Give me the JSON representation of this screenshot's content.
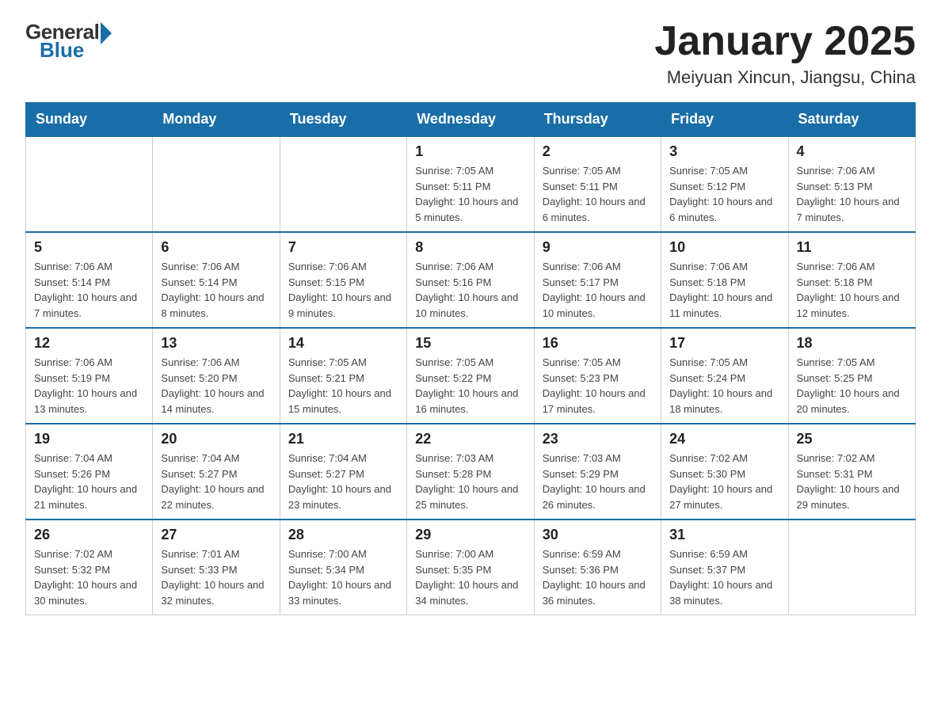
{
  "logo": {
    "general": "General",
    "blue": "Blue"
  },
  "title": "January 2025",
  "subtitle": "Meiyuan Xincun, Jiangsu, China",
  "days_header": [
    "Sunday",
    "Monday",
    "Tuesday",
    "Wednesday",
    "Thursday",
    "Friday",
    "Saturday"
  ],
  "weeks": [
    [
      {
        "day": "",
        "info": ""
      },
      {
        "day": "",
        "info": ""
      },
      {
        "day": "",
        "info": ""
      },
      {
        "day": "1",
        "info": "Sunrise: 7:05 AM\nSunset: 5:11 PM\nDaylight: 10 hours and 5 minutes."
      },
      {
        "day": "2",
        "info": "Sunrise: 7:05 AM\nSunset: 5:11 PM\nDaylight: 10 hours and 6 minutes."
      },
      {
        "day": "3",
        "info": "Sunrise: 7:05 AM\nSunset: 5:12 PM\nDaylight: 10 hours and 6 minutes."
      },
      {
        "day": "4",
        "info": "Sunrise: 7:06 AM\nSunset: 5:13 PM\nDaylight: 10 hours and 7 minutes."
      }
    ],
    [
      {
        "day": "5",
        "info": "Sunrise: 7:06 AM\nSunset: 5:14 PM\nDaylight: 10 hours and 7 minutes."
      },
      {
        "day": "6",
        "info": "Sunrise: 7:06 AM\nSunset: 5:14 PM\nDaylight: 10 hours and 8 minutes."
      },
      {
        "day": "7",
        "info": "Sunrise: 7:06 AM\nSunset: 5:15 PM\nDaylight: 10 hours and 9 minutes."
      },
      {
        "day": "8",
        "info": "Sunrise: 7:06 AM\nSunset: 5:16 PM\nDaylight: 10 hours and 10 minutes."
      },
      {
        "day": "9",
        "info": "Sunrise: 7:06 AM\nSunset: 5:17 PM\nDaylight: 10 hours and 10 minutes."
      },
      {
        "day": "10",
        "info": "Sunrise: 7:06 AM\nSunset: 5:18 PM\nDaylight: 10 hours and 11 minutes."
      },
      {
        "day": "11",
        "info": "Sunrise: 7:06 AM\nSunset: 5:18 PM\nDaylight: 10 hours and 12 minutes."
      }
    ],
    [
      {
        "day": "12",
        "info": "Sunrise: 7:06 AM\nSunset: 5:19 PM\nDaylight: 10 hours and 13 minutes."
      },
      {
        "day": "13",
        "info": "Sunrise: 7:06 AM\nSunset: 5:20 PM\nDaylight: 10 hours and 14 minutes."
      },
      {
        "day": "14",
        "info": "Sunrise: 7:05 AM\nSunset: 5:21 PM\nDaylight: 10 hours and 15 minutes."
      },
      {
        "day": "15",
        "info": "Sunrise: 7:05 AM\nSunset: 5:22 PM\nDaylight: 10 hours and 16 minutes."
      },
      {
        "day": "16",
        "info": "Sunrise: 7:05 AM\nSunset: 5:23 PM\nDaylight: 10 hours and 17 minutes."
      },
      {
        "day": "17",
        "info": "Sunrise: 7:05 AM\nSunset: 5:24 PM\nDaylight: 10 hours and 18 minutes."
      },
      {
        "day": "18",
        "info": "Sunrise: 7:05 AM\nSunset: 5:25 PM\nDaylight: 10 hours and 20 minutes."
      }
    ],
    [
      {
        "day": "19",
        "info": "Sunrise: 7:04 AM\nSunset: 5:26 PM\nDaylight: 10 hours and 21 minutes."
      },
      {
        "day": "20",
        "info": "Sunrise: 7:04 AM\nSunset: 5:27 PM\nDaylight: 10 hours and 22 minutes."
      },
      {
        "day": "21",
        "info": "Sunrise: 7:04 AM\nSunset: 5:27 PM\nDaylight: 10 hours and 23 minutes."
      },
      {
        "day": "22",
        "info": "Sunrise: 7:03 AM\nSunset: 5:28 PM\nDaylight: 10 hours and 25 minutes."
      },
      {
        "day": "23",
        "info": "Sunrise: 7:03 AM\nSunset: 5:29 PM\nDaylight: 10 hours and 26 minutes."
      },
      {
        "day": "24",
        "info": "Sunrise: 7:02 AM\nSunset: 5:30 PM\nDaylight: 10 hours and 27 minutes."
      },
      {
        "day": "25",
        "info": "Sunrise: 7:02 AM\nSunset: 5:31 PM\nDaylight: 10 hours and 29 minutes."
      }
    ],
    [
      {
        "day": "26",
        "info": "Sunrise: 7:02 AM\nSunset: 5:32 PM\nDaylight: 10 hours and 30 minutes."
      },
      {
        "day": "27",
        "info": "Sunrise: 7:01 AM\nSunset: 5:33 PM\nDaylight: 10 hours and 32 minutes."
      },
      {
        "day": "28",
        "info": "Sunrise: 7:00 AM\nSunset: 5:34 PM\nDaylight: 10 hours and 33 minutes."
      },
      {
        "day": "29",
        "info": "Sunrise: 7:00 AM\nSunset: 5:35 PM\nDaylight: 10 hours and 34 minutes."
      },
      {
        "day": "30",
        "info": "Sunrise: 6:59 AM\nSunset: 5:36 PM\nDaylight: 10 hours and 36 minutes."
      },
      {
        "day": "31",
        "info": "Sunrise: 6:59 AM\nSunset: 5:37 PM\nDaylight: 10 hours and 38 minutes."
      },
      {
        "day": "",
        "info": ""
      }
    ]
  ]
}
